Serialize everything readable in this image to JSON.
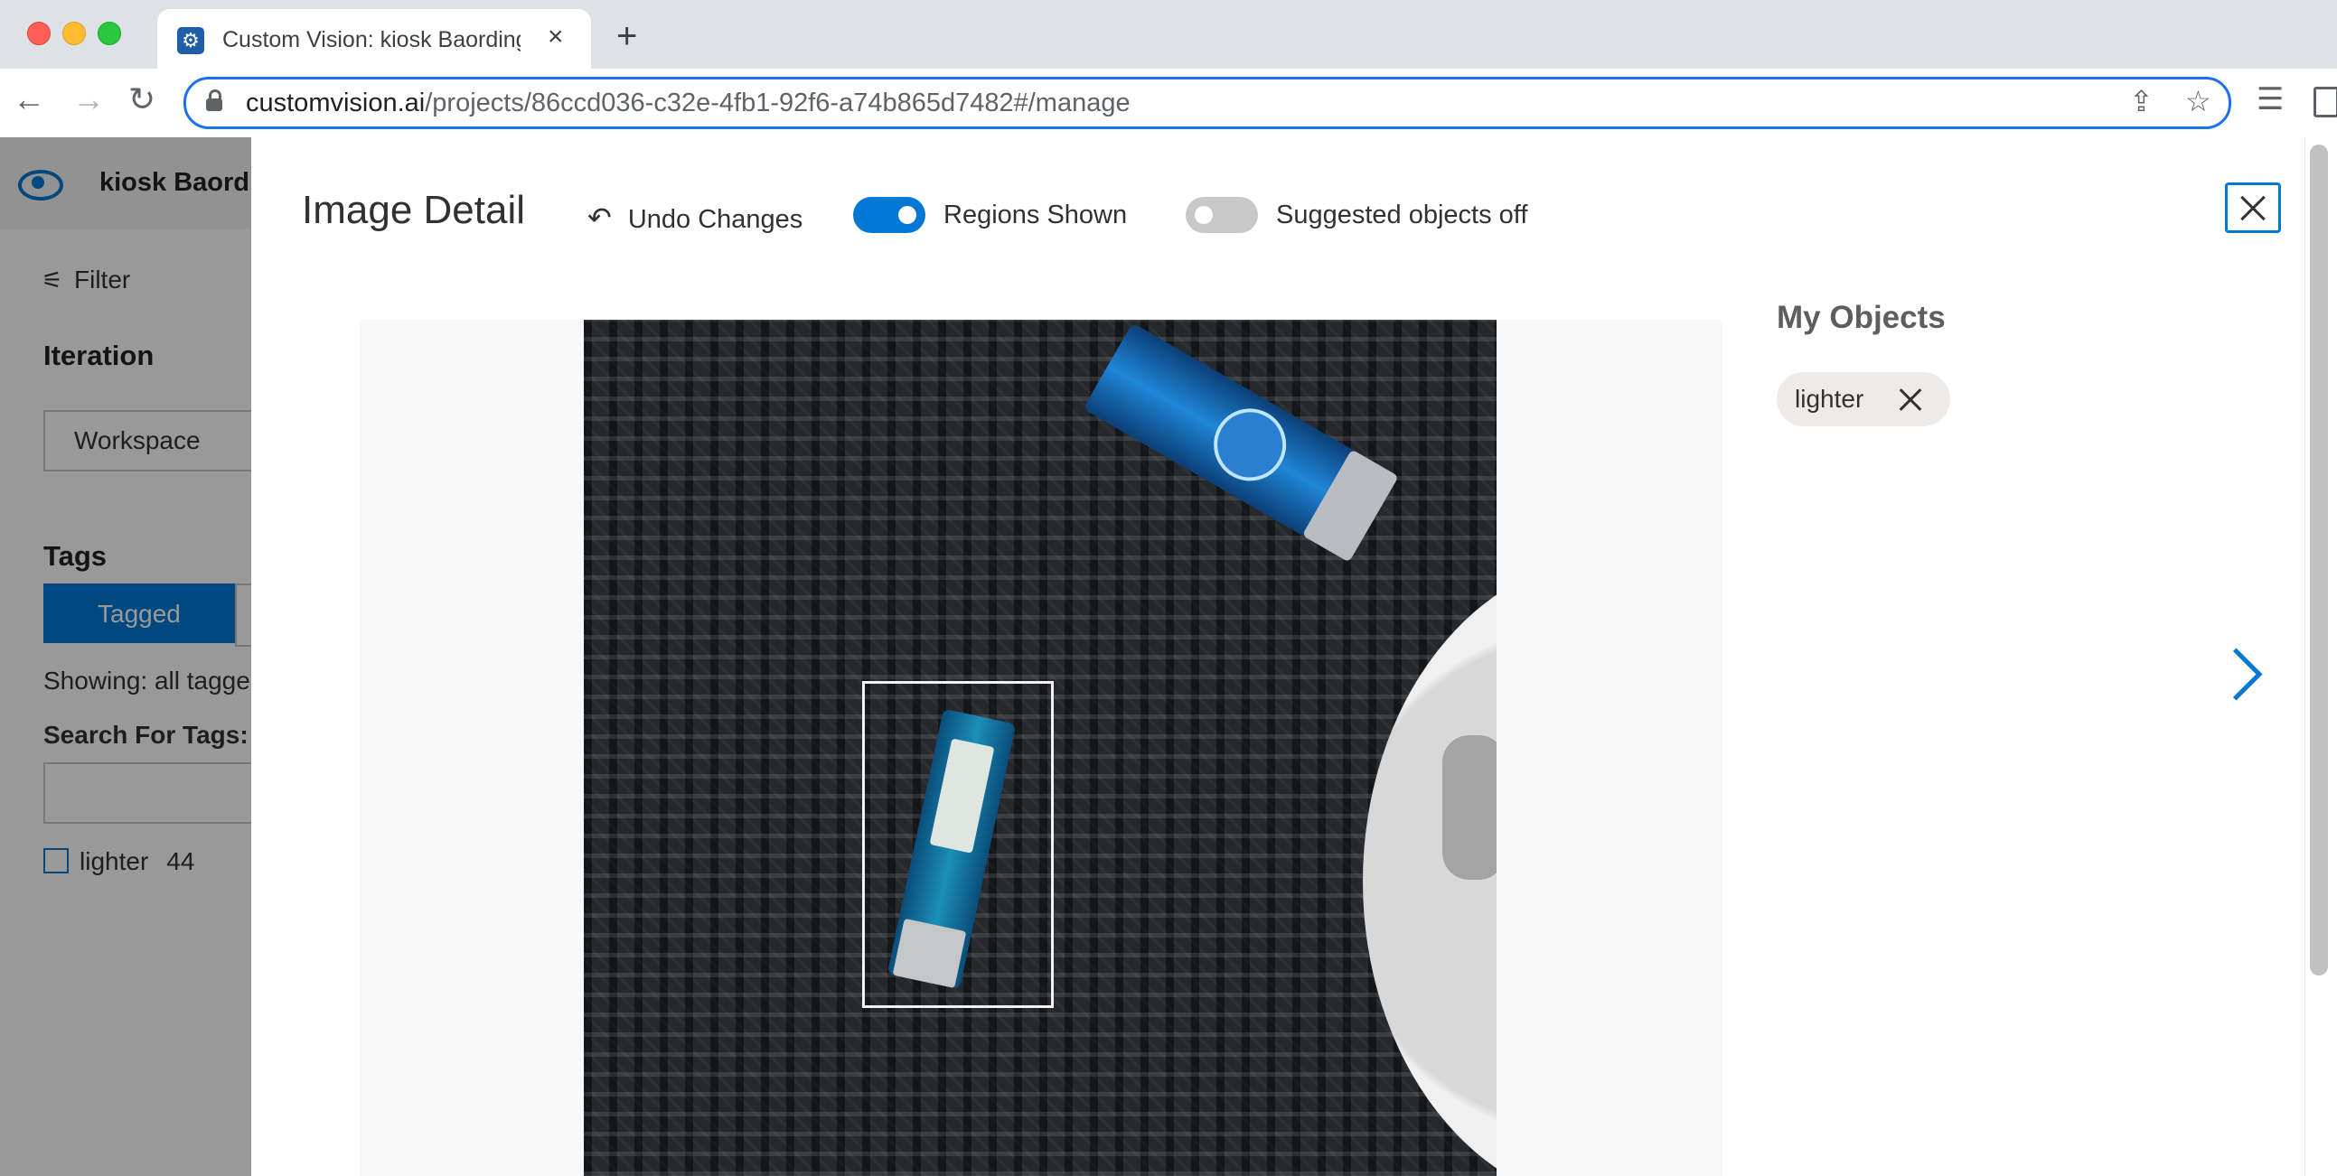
{
  "browser": {
    "tab_title": "Custom Vision: kiosk Baording",
    "tab_favicon": "⚙",
    "tab_close": "×",
    "new_tab": "+",
    "url_domain": "customvision.ai",
    "url_path": "/projects/86ccd036-c32e-4fb1-92f6-a74b865d7482#/manage",
    "icons": [
      "back-icon",
      "forward-icon",
      "reload-icon",
      "lock-icon",
      "share-icon",
      "star-icon",
      "reading-list-icon",
      "side-panel-icon"
    ]
  },
  "app": {
    "project_name": "kiosk Baording",
    "filter_label": "Filter",
    "iteration_label": "Iteration",
    "iteration_value": "Workspace",
    "tags_label": "Tags",
    "tagged_tab": "Tagged",
    "showing": "Showing: all tagged",
    "search_label": "Search For Tags:",
    "tag_list": [
      {
        "name": "lighter",
        "count": "44"
      }
    ]
  },
  "modal": {
    "title": "Image Detail",
    "undo_label": "Undo Changes",
    "regions_label": "Regions Shown",
    "regions_on": true,
    "suggested_label": "Suggested objects off",
    "suggested_on": false,
    "my_objects_title": "My Objects",
    "objects": [
      {
        "tag": "lighter"
      }
    ]
  },
  "colors": {
    "accent": "#0078d4",
    "url_focus": "#1a73e8",
    "chip_bg": "#edebe9"
  }
}
